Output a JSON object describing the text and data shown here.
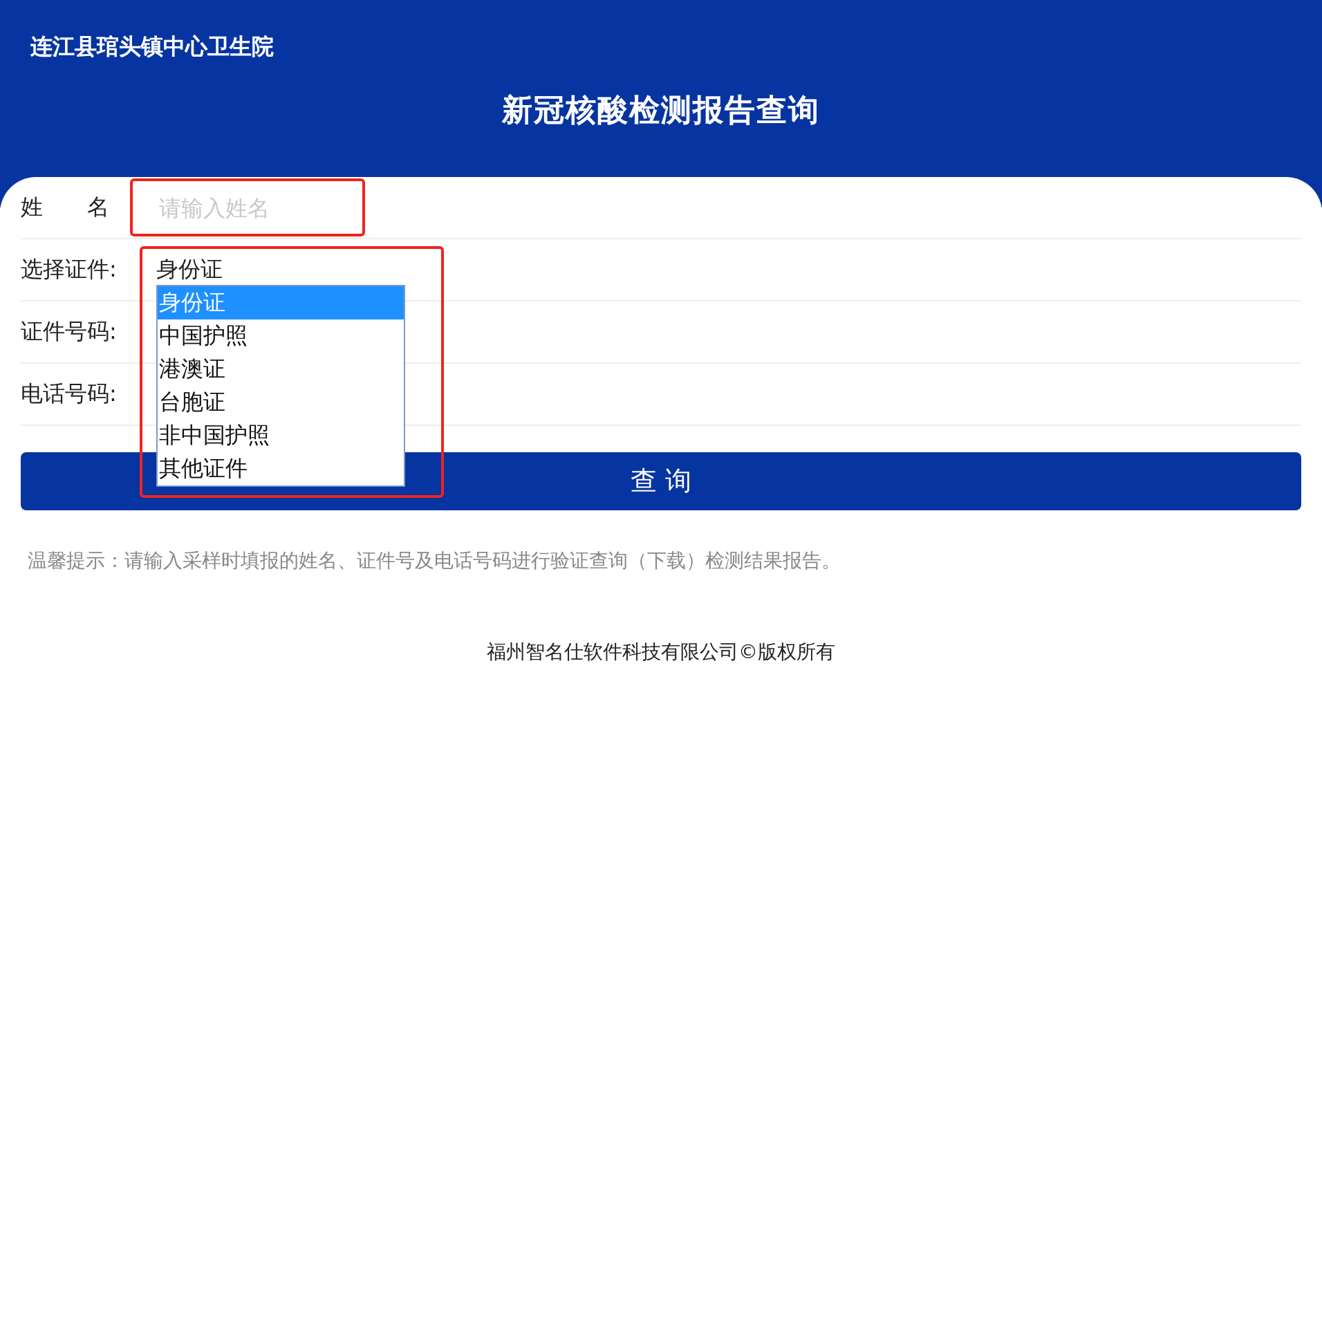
{
  "header": {
    "org_name": "连江县琯头镇中心卫生院",
    "title": "新冠核酸检测报告查询"
  },
  "form": {
    "fields": [
      {
        "kind": "text",
        "label": "姓　　名",
        "placeholder": "请输入姓名",
        "highlighted": true
      },
      {
        "kind": "select",
        "label": "选择证件:",
        "value": "身份证",
        "highlighted": true,
        "expanded": true,
        "options": [
          {
            "label": "身份证",
            "selected": true
          },
          {
            "label": "中国护照",
            "selected": false
          },
          {
            "label": "港澳证",
            "selected": false
          },
          {
            "label": "台胞证",
            "selected": false
          },
          {
            "label": "非中国护照",
            "selected": false
          },
          {
            "label": "其他证件",
            "selected": false
          }
        ]
      },
      {
        "kind": "text",
        "label": "证件号码:",
        "highlighted": false
      },
      {
        "kind": "text",
        "label": "电话号码:",
        "highlighted": false
      }
    ],
    "submit": "查 询"
  },
  "hint": "温馨提示：请输入采样时填报的姓名、证件号及电话号码进行验证查询（下载）检测结果报告。",
  "footer": "福州智名仕软件科技有限公司©版权所有"
}
